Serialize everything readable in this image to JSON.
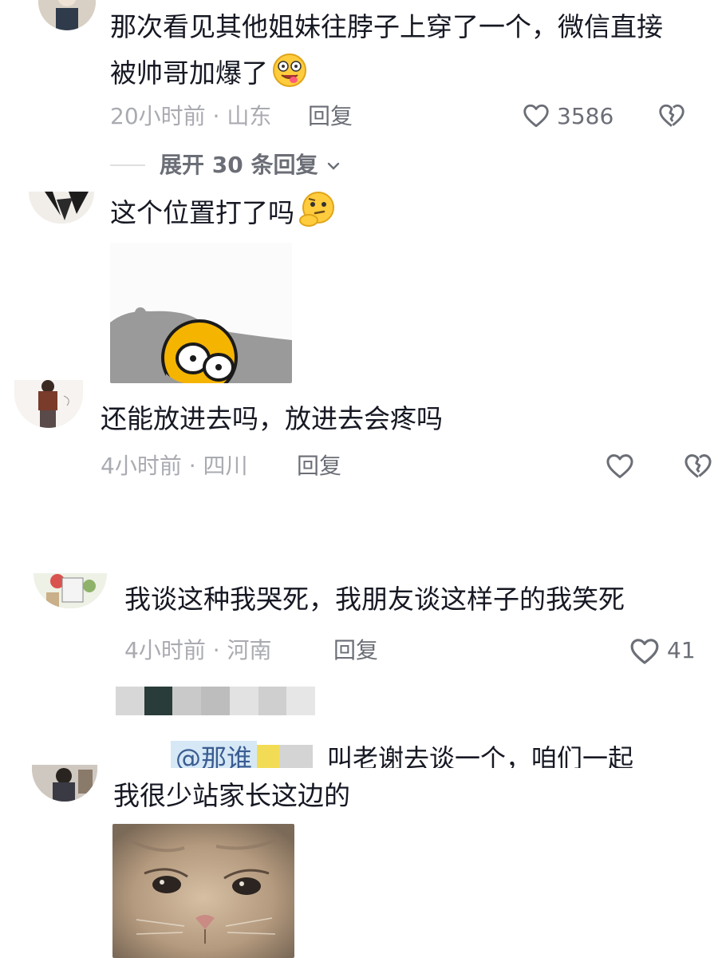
{
  "comments": [
    {
      "text_line1": "那次看见其他姐妹往脖子上穿了一个，微信直接",
      "text_line2": "被帅哥加爆了",
      "emoji": "drooling-face-emoji",
      "time": "20小时前",
      "location": "山东",
      "reply_label": "回复",
      "likes": "3586",
      "expand_label": "展开 30 条回复"
    },
    {
      "text": "这个位置打了吗",
      "emoji": "thinking-face-emoji",
      "sticker": "peeking-yellow-face-sticker"
    },
    {
      "text": "还能放进去吗，放进去会疼吗",
      "time": "4小时前",
      "location": "四川",
      "reply_label": "回复"
    },
    {
      "text": "我谈这种我哭死，我朋友谈这样子的我笑死",
      "time": "4小时前",
      "location": "河南",
      "reply_label": "回复",
      "likes": "41",
      "blurred_user_colors": [
        "#d7d7d7",
        "#2a3c39",
        "#c9c9c9",
        "#bdbdbd",
        "#e2e2e2",
        "#cfcfcf",
        "#e6e6e6"
      ],
      "reply_preview": {
        "mention": "@那谁",
        "text": "叫老谢去谈一个，咱们一起"
      }
    },
    {
      "text": "我很少站家长这边的",
      "sticker": "sad-cat-sticker"
    }
  ],
  "meta_separator": "·",
  "colors": {
    "text": "#161823",
    "meta": "#a9abb1",
    "action": "#6b6e76",
    "mention": "#3a5c91"
  }
}
